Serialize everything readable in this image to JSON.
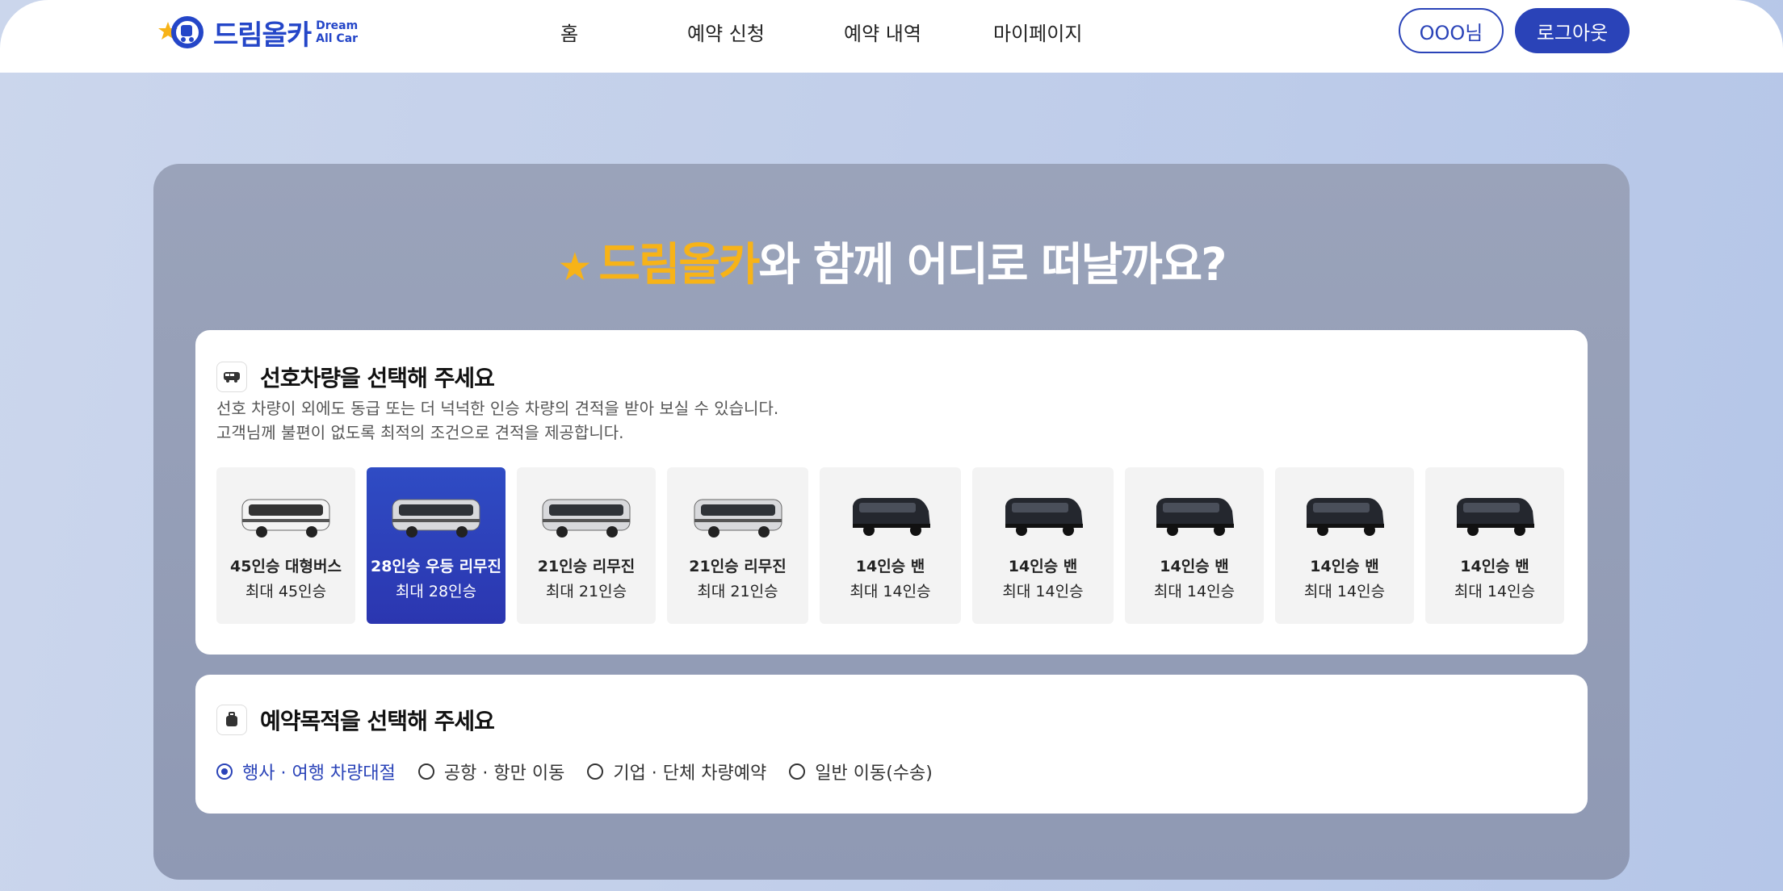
{
  "header": {
    "logo_text": "드림올카",
    "logo_sub_1": "Dream",
    "logo_sub_2": "All Car",
    "nav": [
      "홈",
      "예약 신청",
      "예약 내역",
      "마이페이지"
    ],
    "user_label": "OOO님",
    "logout_label": "로그아웃"
  },
  "hero": {
    "accent": "드림올카",
    "rest": "와 함께 어디로 떠날까요?"
  },
  "vehicle_section": {
    "title": "선호차량을 선택해 주세요",
    "desc_1": "선호 차량이 외에도 동급 또는 더 넉넉한 인승 차량의 견적을 받아 보실 수 있습니다.",
    "desc_2": "고객님께 불편이 없도록 최적의 조건으로 견적을 제공합니다.",
    "items": [
      {
        "name": "45인승 대형버스",
        "cap": "최대 45인승",
        "kind": "bus-white"
      },
      {
        "name": "28인승 우등 리무진",
        "cap": "최대 28인승",
        "kind": "bus-grey",
        "selected": true
      },
      {
        "name": "21인승  리무진",
        "cap": "최대 21인승",
        "kind": "bus-grey"
      },
      {
        "name": "21인승  리무진",
        "cap": "최대 21인승",
        "kind": "bus-grey"
      },
      {
        "name": "14인승 밴",
        "cap": "최대 14인승",
        "kind": "van"
      },
      {
        "name": "14인승 밴",
        "cap": "최대 14인승",
        "kind": "van"
      },
      {
        "name": "14인승 밴",
        "cap": "최대 14인승",
        "kind": "van"
      },
      {
        "name": "14인승 밴",
        "cap": "최대 14인승",
        "kind": "van"
      },
      {
        "name": "14인승 밴",
        "cap": "최대 14인승",
        "kind": "van"
      }
    ]
  },
  "purpose_section": {
    "title": "예약목적을 선택해 주세요",
    "options": [
      "행사 · 여행 차량대절",
      "공항 · 항만 이동",
      "기업 · 단체 차량예약",
      "일반 이동(수송)"
    ],
    "selected_index": 0
  },
  "colors": {
    "primary": "#2a43b8",
    "accent": "#f7b318"
  }
}
